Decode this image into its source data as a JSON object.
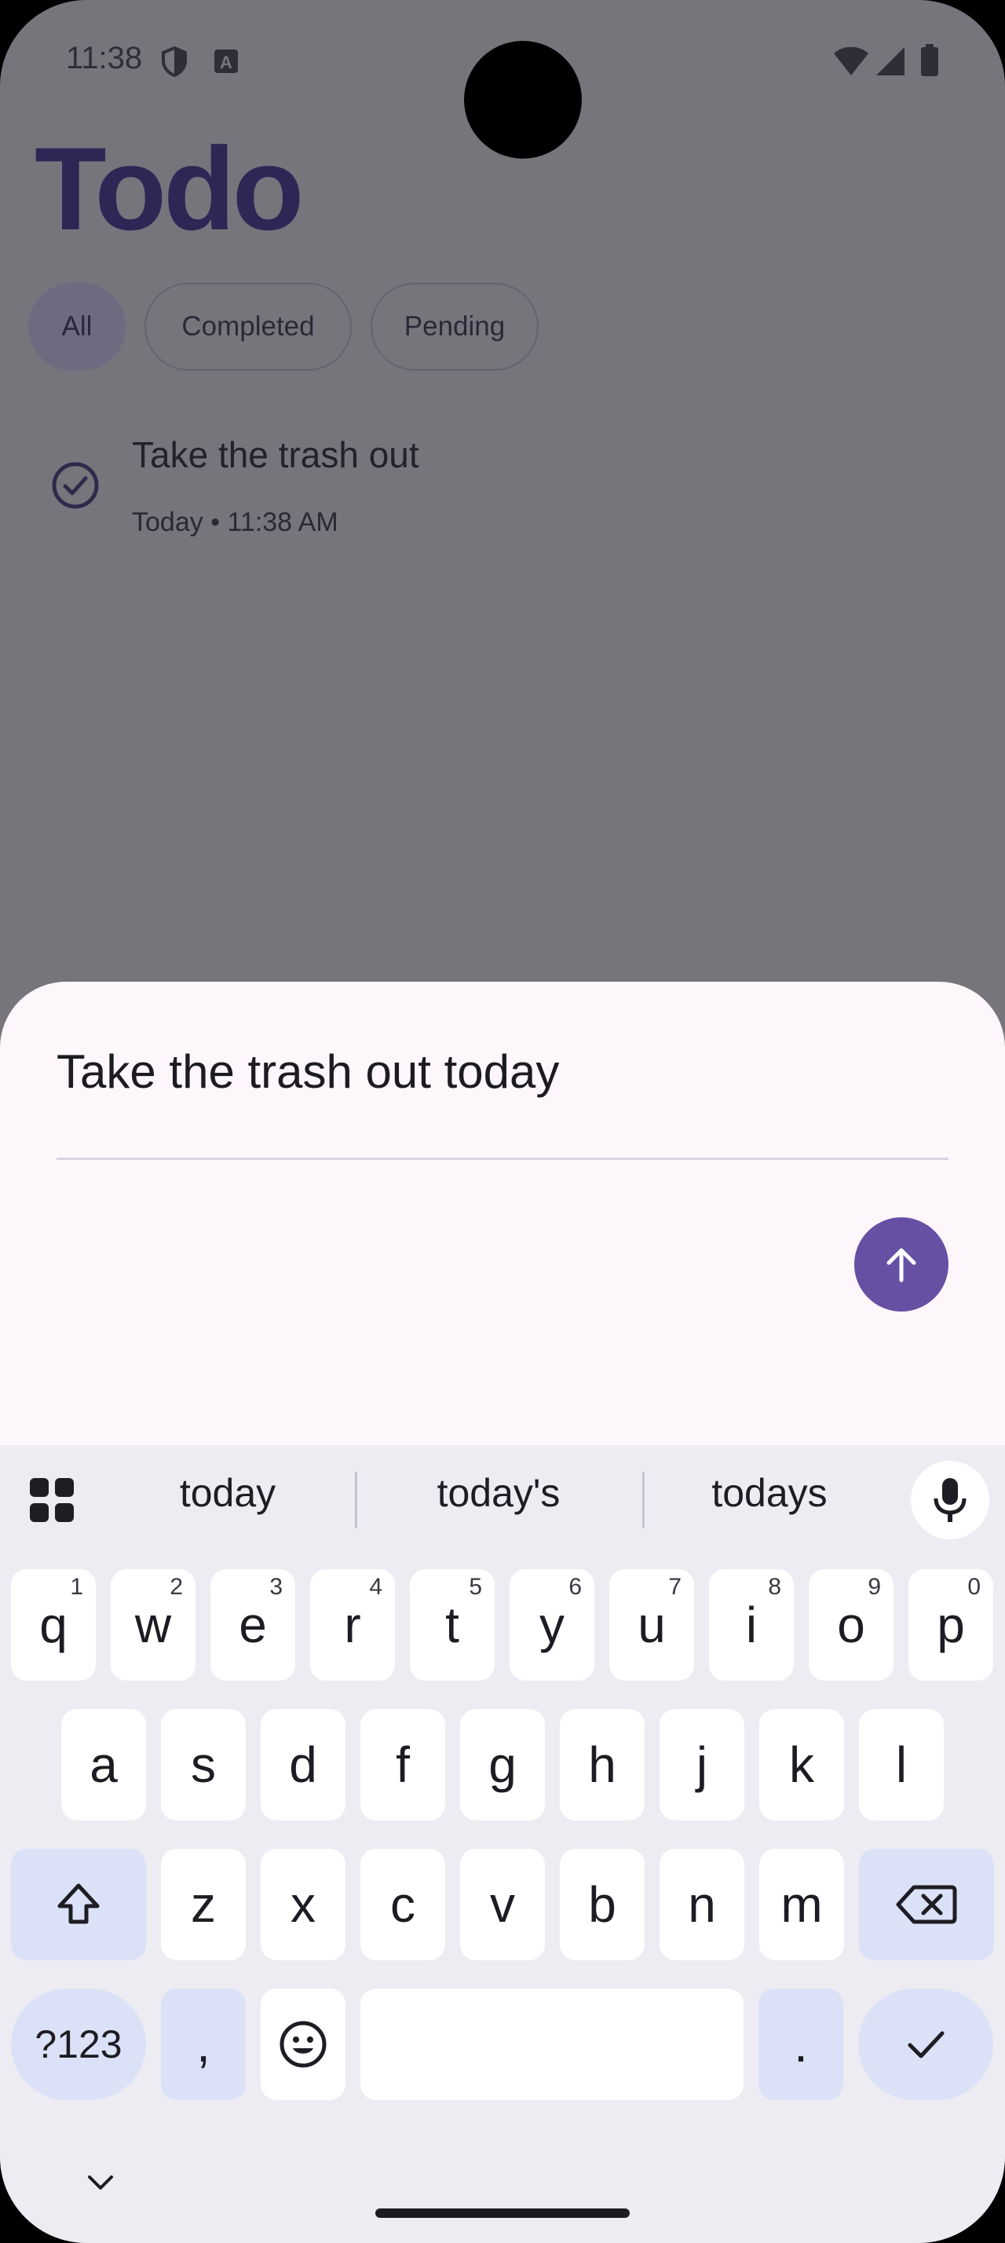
{
  "status_bar": {
    "time": "11:38",
    "icons_left": [
      "shield-icon",
      "keyboard-a-icon"
    ],
    "icons_right": [
      "wifi-icon",
      "signal-icon",
      "battery-icon"
    ]
  },
  "app": {
    "title": "Todo",
    "filters": [
      {
        "label": "All",
        "selected": true
      },
      {
        "label": "Completed",
        "selected": false
      },
      {
        "label": "Pending",
        "selected": false
      }
    ],
    "todos": [
      {
        "title": "Take the trash out",
        "subtitle": "Today • 11:38 AM",
        "completed": true
      }
    ]
  },
  "sheet": {
    "input_value": "Take the trash out today",
    "send_icon": "arrow-up-icon"
  },
  "keyboard": {
    "suggestions": [
      "today",
      "today's",
      "todays"
    ],
    "row1": [
      {
        "key": "q",
        "hint": "1"
      },
      {
        "key": "w",
        "hint": "2"
      },
      {
        "key": "e",
        "hint": "3"
      },
      {
        "key": "r",
        "hint": "4"
      },
      {
        "key": "t",
        "hint": "5"
      },
      {
        "key": "y",
        "hint": "6"
      },
      {
        "key": "u",
        "hint": "7"
      },
      {
        "key": "i",
        "hint": "8"
      },
      {
        "key": "o",
        "hint": "9"
      },
      {
        "key": "p",
        "hint": "0"
      }
    ],
    "row2": [
      "a",
      "s",
      "d",
      "f",
      "g",
      "h",
      "j",
      "k",
      "l"
    ],
    "row3": [
      "z",
      "x",
      "c",
      "v",
      "b",
      "n",
      "m"
    ],
    "symbols_label": "?123",
    "comma_label": ",",
    "period_label": ".",
    "colors": {
      "accent": "#6550a4",
      "func_key": "#dbe1f6"
    }
  }
}
